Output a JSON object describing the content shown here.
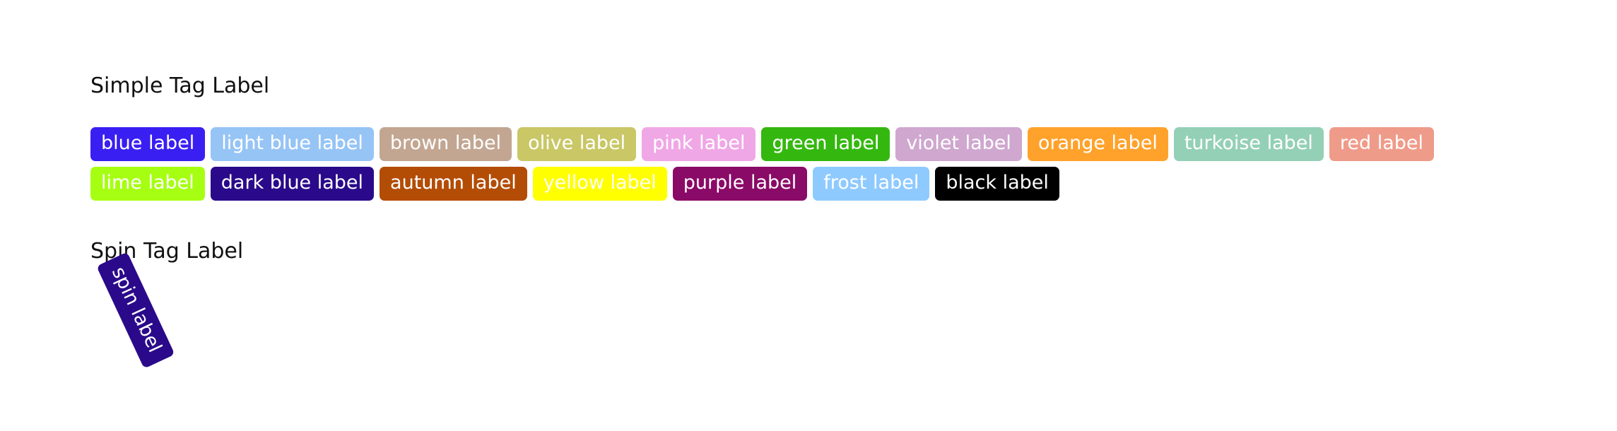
{
  "simple_section": {
    "title": "Simple Tag Label",
    "row1": [
      {
        "label": "blue label",
        "color": "#3a1ff2"
      },
      {
        "label": "light blue label",
        "color": "#96c4f5"
      },
      {
        "label": "brown label",
        "color": "#c2a691"
      },
      {
        "label": "olive label",
        "color": "#c9c766"
      },
      {
        "label": "pink label",
        "color": "#f0a7e6"
      },
      {
        "label": "green label",
        "color": "#34b80f"
      },
      {
        "label": "violet label",
        "color": "#cfa7cf"
      },
      {
        "label": "orange label",
        "color": "#ffa22b"
      },
      {
        "label": "turkoise label",
        "color": "#94d0b6"
      },
      {
        "label": "red label",
        "color": "#ef9b8a"
      }
    ],
    "row2": [
      {
        "label": "lime label",
        "color": "#a6ff12"
      },
      {
        "label": "dark blue label",
        "color": "#2a0a8a"
      },
      {
        "label": "autumn label",
        "color": "#b34c05"
      },
      {
        "label": "yellow label",
        "color": "#ffff00"
      },
      {
        "label": "purple label",
        "color": "#8a0a67"
      },
      {
        "label": "frost label",
        "color": "#8fcaff"
      },
      {
        "label": "black label",
        "color": "#000000"
      }
    ]
  },
  "spin_section": {
    "title": "Spin Tag Label",
    "tag": {
      "label": "spin label",
      "color": "#2a0a8a"
    }
  }
}
